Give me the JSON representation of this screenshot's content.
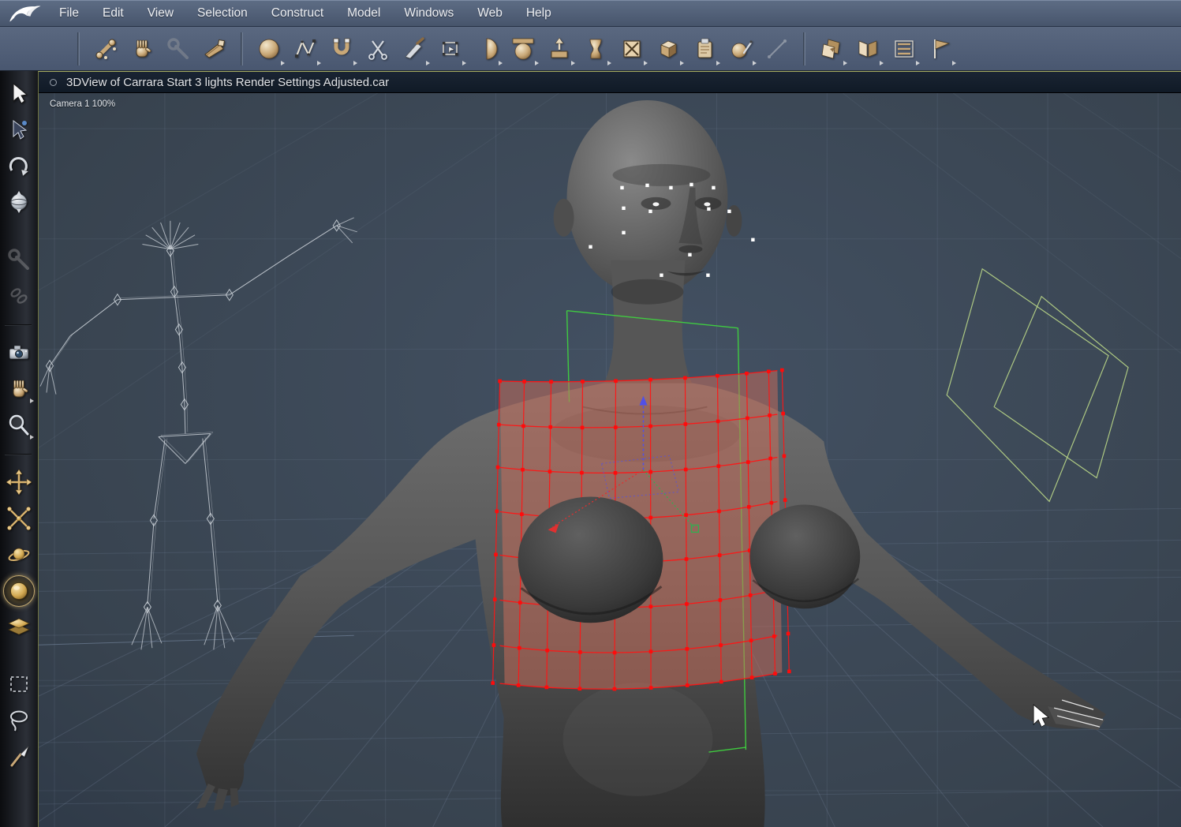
{
  "app_name": "Carrara",
  "menu_bar": {
    "items": [
      "File",
      "Edit",
      "View",
      "Selection",
      "Construct",
      "Model",
      "Windows",
      "Web",
      "Help"
    ]
  },
  "top_toolbar": {
    "groups": [
      {
        "tools": [
          {
            "name": "joint-editor-tool",
            "icon": "bone"
          },
          {
            "name": "pan-hand-tool",
            "icon": "hand"
          },
          {
            "name": "wrench-tool",
            "icon": "wrench",
            "disabled": true
          },
          {
            "name": "sharpener-tool",
            "icon": "sharpener"
          }
        ]
      },
      {
        "tools": [
          {
            "name": "sphere-primitive-tool",
            "icon": "sphere",
            "flyout": true
          },
          {
            "name": "spline-tool",
            "icon": "spline",
            "flyout": true
          },
          {
            "name": "magnet-tool",
            "icon": "magnet",
            "flyout": true
          },
          {
            "name": "scissors-tool",
            "icon": "scissors"
          },
          {
            "name": "knife-tool",
            "icon": "knife",
            "flyout": true
          },
          {
            "name": "rect-selection-tool",
            "icon": "rect-select",
            "flyout": true
          },
          {
            "name": "half-sphere-tool",
            "icon": "half-sphere",
            "flyout": true
          },
          {
            "name": "flatten-tool",
            "icon": "flatten",
            "flyout": true
          },
          {
            "name": "extrude-tool",
            "icon": "extrude",
            "flyout": true
          },
          {
            "name": "lathe-tool",
            "icon": "vase",
            "flyout": true
          },
          {
            "name": "boolean-tool",
            "icon": "boolean",
            "flyout": true
          },
          {
            "name": "block-tool",
            "icon": "block",
            "flyout": true
          },
          {
            "name": "clipboard-tool",
            "icon": "clipboard",
            "flyout": true
          },
          {
            "name": "shader-sphere-tool",
            "icon": "paint-sphere",
            "flyout": true
          },
          {
            "name": "line-tool",
            "icon": "line",
            "disabled": true
          }
        ]
      },
      {
        "tools": [
          {
            "name": "page-duplicate-tool",
            "icon": "page-duplicate",
            "flyout": true
          },
          {
            "name": "page-mirror-tool",
            "icon": "page-mirror",
            "flyout": true
          },
          {
            "name": "align-tool",
            "icon": "align",
            "flyout": true
          },
          {
            "name": "page-flag-tool",
            "icon": "page-flag",
            "flyout": true
          }
        ]
      }
    ]
  },
  "left_toolbar": {
    "groups": [
      {
        "tools": [
          {
            "name": "select-arrow-tool",
            "icon": "arrow-white"
          },
          {
            "name": "direct-select-tool",
            "icon": "arrow-dark"
          },
          {
            "name": "rotate-tool",
            "icon": "rotate-arrow"
          },
          {
            "name": "trackball-tool",
            "icon": "trackball"
          }
        ]
      },
      {
        "tools": [
          {
            "name": "wrench-tool",
            "icon": "wrench",
            "disabled": true
          },
          {
            "name": "link-tool",
            "icon": "chain-links",
            "disabled": true
          }
        ]
      },
      {
        "tools": [
          {
            "name": "camera-tool",
            "icon": "camera"
          },
          {
            "name": "pan-tool",
            "icon": "hand",
            "flyout": true
          },
          {
            "name": "zoom-tool",
            "icon": "magnifier",
            "flyout": true
          }
        ]
      },
      {
        "tools": [
          {
            "name": "move-camera-tool",
            "icon": "gold-move"
          },
          {
            "name": "pan-camera-tool",
            "icon": "gold-move2"
          },
          {
            "name": "orbit-camera-tool",
            "icon": "gold-orbit"
          },
          {
            "name": "dolly-camera-tool",
            "icon": "gold-sphere",
            "active": true
          },
          {
            "name": "bank-camera-tool",
            "icon": "gold-planes"
          }
        ]
      },
      {
        "tools": [
          {
            "name": "marquee-tool",
            "icon": "dashed-rect"
          },
          {
            "name": "lasso-tool",
            "icon": "lasso"
          },
          {
            "name": "paint-brush-tool",
            "icon": "brush"
          }
        ]
      }
    ]
  },
  "viewport": {
    "title": "3DView of Carrara Start 3 lights Render Settings Adjusted.car",
    "camera_label": "Camera 1 100%"
  },
  "scene": {
    "colors": {
      "background": "#3d4a5c",
      "grid": "#8fa2bf",
      "mesh_line": "#ff1515",
      "mesh_dot": "#ff0b0b",
      "mesh_fill": "rgba(205,110,90,0.5)",
      "selection_green": "#3fd23f",
      "wireframe_green": "#b9d687",
      "skeleton": "#c9cfd6",
      "handle_white": "#ffffff",
      "gizmo_blue": "#5050e8",
      "gizmo_red": "#e03030",
      "gizmo_green": "#30b050"
    }
  }
}
